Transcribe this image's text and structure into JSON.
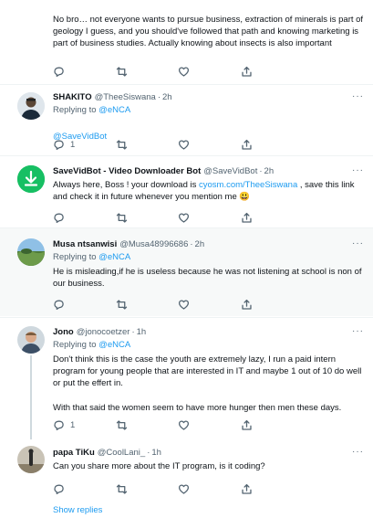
{
  "tweets": [
    {
      "body": "No bro… not everyone wants to pursue business, extraction of minerals is part of geology I guess, and you should've followed that path and knowing marketing is part of business studies. Actually knowing about insects is also important",
      "replies": ""
    },
    {
      "name": "SHAKITO",
      "handle": "@TheeSiswana",
      "time": "2h",
      "replying_prefix": "Replying to",
      "replying_to": "@eNCA",
      "body_link": "@SaveVidBot",
      "replies": "1"
    },
    {
      "name": "SaveVidBot - Video Downloader Bot",
      "handle": "@SaveVidBot",
      "time": "2h",
      "body_pre": "Always here, Boss ! your download is",
      "body_link": "cyosm.com/TheeSiswana",
      "body_post": ", save this link and check it in future whenever you mention me 😃",
      "replies": ""
    },
    {
      "name": "Musa ntsanwisi",
      "handle": "@Musa48996686",
      "time": "2h",
      "replying_prefix": "Replying to",
      "replying_to": "@eNCA",
      "body": "He is misleading,if he is useless because he was not listening at school is non of our business.",
      "replies": ""
    },
    {
      "name": "Jono",
      "handle": "@jonocoetzer",
      "time": "1h",
      "replying_prefix": "Replying to",
      "replying_to": "@eNCA",
      "body": "Don't think this is the case the youth are extremely lazy, I run a paid intern program for young people that are interested in IT and maybe 1 out of 10 do well or put the effert in.\n\nWith that said the women seem to have more hunger then men these days.",
      "replies": "1"
    },
    {
      "name": "papa TiKu",
      "handle": "@CoolLani_",
      "time": "1h",
      "body": "Can you share more about the IT program, is it coding?",
      "replies": ""
    }
  ],
  "show_replies": "Show replies",
  "dot": "·",
  "more_glyph": "···",
  "icons": [
    "reply-icon",
    "retweet-icon",
    "like-icon",
    "share-icon",
    "more-icon",
    "download-icon"
  ],
  "colors": {
    "link": "#1d9bf0",
    "muted": "#536471",
    "highlight_bg": "#f7f9f9",
    "bot_avatar": "#17bf63"
  }
}
